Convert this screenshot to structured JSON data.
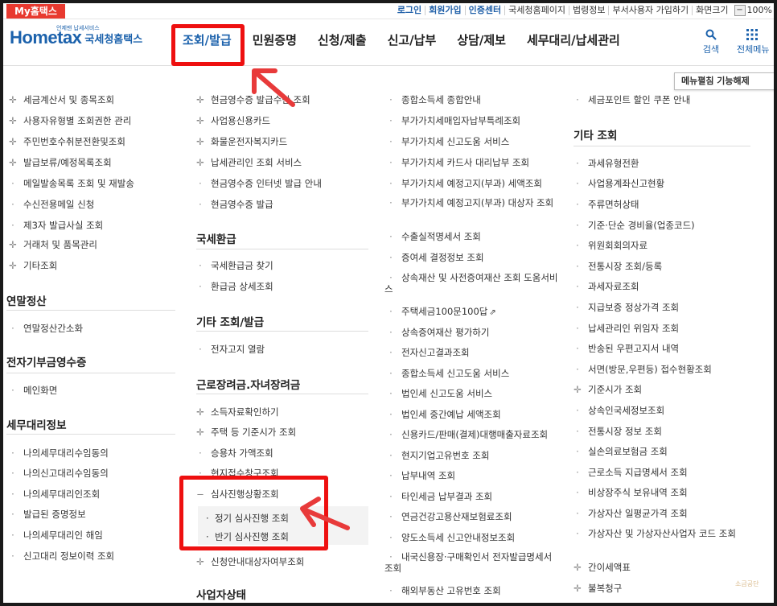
{
  "topbar": {
    "my_tab": "My홈택스",
    "utils": [
      "로그인",
      "회원가입",
      "인증센터",
      "국세청홈페이지",
      "법령정보",
      "부서사용자 가입하기",
      "화면크기"
    ],
    "zoom": "100%"
  },
  "header": {
    "logo_en": "Hometax",
    "logo_sub": "언제맨 납세서비스",
    "logo_ko": "국세청홈택스",
    "gnb": [
      "조회/발급",
      "민원증명",
      "신청/제출",
      "신고/납부",
      "상담/제보",
      "세무대리/납세관리"
    ],
    "search_label": "검색",
    "all_menu_label": "전체메뉴",
    "menu_toggle": "메뉴펼침 기능해제"
  },
  "col1": {
    "items_a": [
      "세금계산서 및 종목조회",
      "사용자유형별 조회권한 관리",
      "주민번호수취분전환및조회",
      "발급보류/예정목록조회",
      "메일발송목록 조회 및 재발송",
      "수신전용메일 신청",
      "제3자 발급사실 조회",
      "거래처 및 품목관리",
      "기타조회"
    ],
    "h_year_end": "연말정산",
    "items_b": [
      "연말정산간소화"
    ],
    "h_donation": "전자기부금영수증",
    "items_c": [
      "메인화면"
    ],
    "h_agent": "세무대리정보",
    "items_d": [
      "나의세무대리수임동의",
      "나의신고대리수임동의",
      "나의세무대리인조회",
      "발급된 증명정보",
      "나의세무대리인 해임",
      "신고대리 정보이력 조회"
    ]
  },
  "col2": {
    "items_a": [
      "현금영수증 발급수단 조회",
      "사업용신용카드",
      "화물운전자복지카드",
      "납세관리인 조회 서비스",
      "현금영수증 인터넷 발급 안내",
      "현금영수증 발급"
    ],
    "h_refund": "국세환급",
    "items_b": [
      "국세환급금 찾기",
      "환급금 상세조회"
    ],
    "h_etc": "기타 조회/발급",
    "items_c": [
      "전자고지 열람"
    ],
    "h_labor": "근로장려금.자녀장려금",
    "items_d": [
      "소득자료확인하기",
      "주택 등 기준시가 조회",
      "승용차 가액조회",
      "현지접수창구조회"
    ],
    "audit": "심사진행상황조회",
    "audit_subs": [
      "정기 심사진행 조회",
      "반기 심사진행 조회"
    ],
    "items_e": [
      "신청안내대상자여부조회"
    ],
    "h_biz": "사업자상태"
  },
  "col3": {
    "items": [
      "종합소득세 종합안내",
      "부가가치세매입자납부특례조회",
      "부가가치세 신고도움 서비스",
      "부가가치세 카드사 대리납부 조회",
      "부가가치세 예정고지(부과) 세액조회",
      "부가가치세 예정고지(부과) 대상자 조회",
      "수출실적명세서 조회",
      "증여세 결정정보 조회",
      "상속재산 및 사전증여재산 조회 도움서비스",
      "주택세금100문100답",
      "상속증여재산 평가하기",
      "전자신고결과조회",
      "종합소득세 신고도움 서비스",
      "법인세 신고도움 서비스",
      "법인세 중간예납 세액조회",
      "신용카드/판매(결제)대행매출자료조회",
      "현지기업고유번호 조회",
      "납부내역 조회",
      "타인세금 납부결과 조회",
      "연금건강고용산재보험료조회",
      "양도소득세 신고안내정보조회",
      "내국신용장·구매확인서 전자발급명세서 조회",
      "해외부동산 고유번호 조회"
    ]
  },
  "col4": {
    "items_a": [
      "세금포인트 할인 쿠폰 안내"
    ],
    "h_etc": "기타 조회",
    "items_b": [
      "과세유형전환",
      "사업용계좌신고현황",
      "주류면허상태",
      "기준·단순 경비율(업종코드)",
      "위원회회의자료",
      "전통시장 조회/등록",
      "과세자료조회",
      "지급보증 정상가격 조회",
      "납세관리인 위임자 조회",
      "반송된 우편고지서 내역",
      "서면(방문,우편등) 접수현황조회",
      "기준시가 조회",
      "상속인국세정보조회",
      "전통시장 정보 조회",
      "실손의료보험금 조회",
      "근로소득 지급명세서 조회",
      "비상장주식 보유내역 조회",
      "가상자산 일평균가격 조회",
      "가상자산 및 가상자산사업자 코드 조회",
      "간이세액표",
      "불복청구"
    ]
  },
  "watermark": "소금공단",
  "colors": {
    "brand": "#1c62ac",
    "highlight": "#ee1010",
    "my_tab": "#e8392f"
  }
}
